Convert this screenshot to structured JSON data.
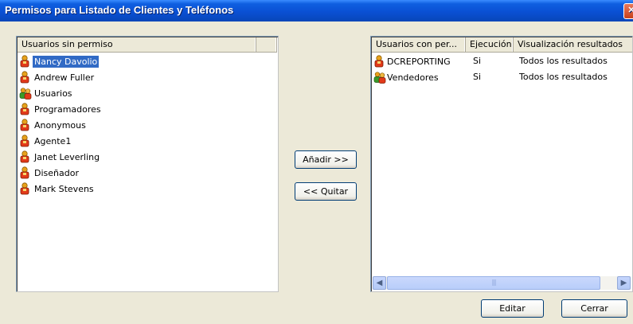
{
  "window": {
    "title": "Permisos para Listado de Clientes y Teléfonos"
  },
  "left_list": {
    "header": "Usuarios sin permiso",
    "items": [
      {
        "label": "Nancy Davolio",
        "icon": "user-icon",
        "selected": true
      },
      {
        "label": "Andrew Fuller",
        "icon": "user-icon"
      },
      {
        "label": "Usuarios",
        "icon": "group-icon"
      },
      {
        "label": "Programadores",
        "icon": "user-icon"
      },
      {
        "label": "Anonymous",
        "icon": "user-icon"
      },
      {
        "label": "Agente1",
        "icon": "user-icon"
      },
      {
        "label": "Janet Leverling",
        "icon": "user-icon"
      },
      {
        "label": "Diseñador",
        "icon": "user-icon"
      },
      {
        "label": "Mark Stevens",
        "icon": "user-icon"
      }
    ]
  },
  "buttons": {
    "add": "Añadir >>",
    "remove": "<< Quitar",
    "edit": "Editar",
    "close": "Cerrar"
  },
  "right_list": {
    "headers": [
      "Usuarios con per...",
      "Ejecución",
      "Visualización resultados"
    ],
    "rows": [
      {
        "name": "DCREPORTING",
        "execution": "Si",
        "visualization": "Todos los resultados",
        "icon": "user-icon"
      },
      {
        "name": "Vendedores",
        "execution": "Si",
        "visualization": "Todos los resultados",
        "icon": "group-icon"
      }
    ]
  },
  "colors": {
    "title_bar": "#0a50d4",
    "selection": "#316ac5",
    "dialog_bg": "#ece9d8"
  }
}
